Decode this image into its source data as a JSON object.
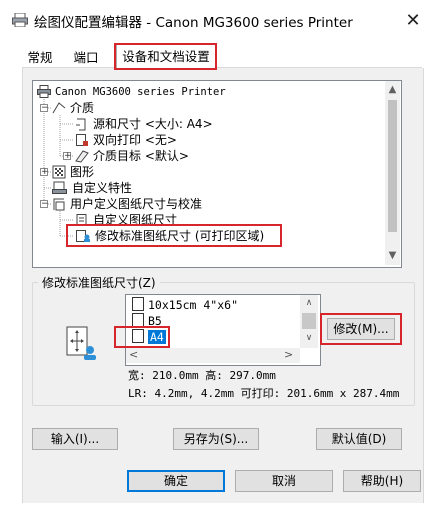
{
  "window": {
    "title": "绘图仪配置编辑器 - Canon MG3600 series Printer",
    "close_glyph": "✕"
  },
  "tabs": [
    {
      "label": "常规"
    },
    {
      "label": "端口"
    },
    {
      "label": "设备和文档设置"
    }
  ],
  "tree": {
    "items": [
      {
        "label": "Canon MG3600 series Printer"
      },
      {
        "label": "介质"
      },
      {
        "label": "源和尺寸 <大小: A4>"
      },
      {
        "label": "双向打印 <无>"
      },
      {
        "label": "介质目标 <默认>"
      },
      {
        "label": "图形"
      },
      {
        "label": "自定义特性"
      },
      {
        "label": "用户定义图纸尺寸与校准"
      },
      {
        "label": "自定义图纸尺寸"
      },
      {
        "label": "修改标准图纸尺寸 (可打印区域)"
      }
    ]
  },
  "group": {
    "title": "修改标准图纸尺寸(Z)",
    "list": [
      {
        "label": "10x15cm 4\"x6\""
      },
      {
        "label": "B5"
      },
      {
        "label": "A4"
      }
    ],
    "modify_button": "修改(M)...",
    "info_line1": "宽: 210.0mm 高: 297.0mm",
    "info_line2": "LR: 4.2mm, 4.2mm   可打印: 201.6mm x 287.4mm"
  },
  "bottom_buttons": {
    "import": "输入(I)...",
    "save_as": "另存为(S)...",
    "defaults": "默认值(D)"
  },
  "dialog_buttons": {
    "ok": "确定",
    "cancel": "取消",
    "help": "帮助(H)"
  },
  "colors": {
    "highlight_red": "#d6262c",
    "selection_blue": "#0078d7"
  }
}
